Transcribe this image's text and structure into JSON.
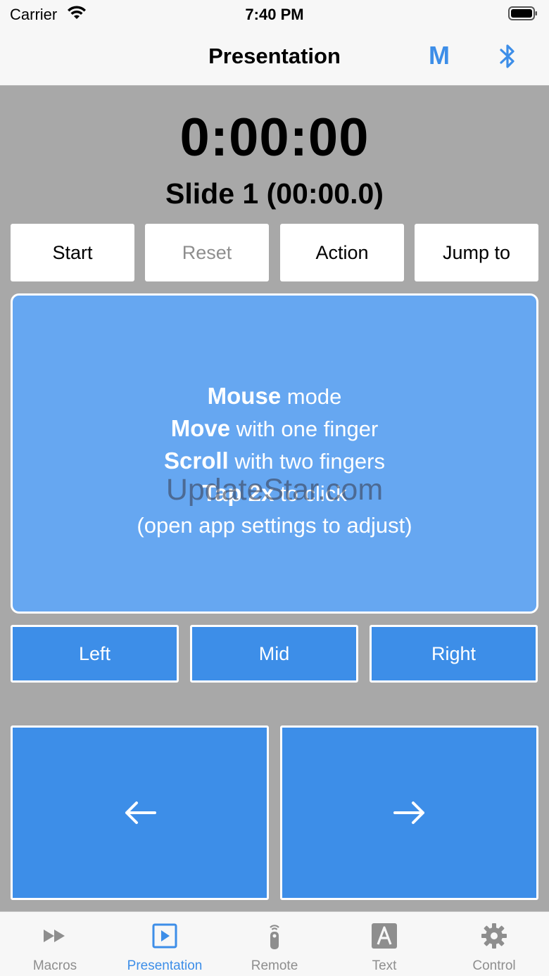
{
  "status_bar": {
    "carrier": "Carrier",
    "time": "7:40 PM"
  },
  "nav": {
    "title": "Presentation",
    "macro_button": "M"
  },
  "timer": {
    "elapsed": "0:00:00",
    "slide": "Slide 1 (00:00.0)"
  },
  "controls": [
    {
      "label": "Start",
      "enabled": true
    },
    {
      "label": "Reset",
      "enabled": false
    },
    {
      "label": "Action",
      "enabled": true
    },
    {
      "label": "Jump to",
      "enabled": true
    }
  ],
  "trackpad": {
    "line1_bold": "Mouse",
    "line1_rest": " mode",
    "line2_bold": "Move",
    "line2_rest": " with one finger",
    "line3_bold": "Scroll",
    "line3_rest": " with two fingers",
    "line4_bold": "Tap 2x",
    "line4_rest": " to click",
    "line5": "(open app settings to adjust)",
    "watermark": "UpdateStar.com"
  },
  "mouse_buttons": {
    "left": "Left",
    "mid": "Mid",
    "right": "Right"
  },
  "tabs": [
    {
      "label": "Macros",
      "icon": "fast-forward-icon",
      "active": false
    },
    {
      "label": "Presentation",
      "icon": "presentation-icon",
      "active": true
    },
    {
      "label": "Remote",
      "icon": "remote-icon",
      "active": false
    },
    {
      "label": "Text",
      "icon": "text-icon",
      "active": false
    },
    {
      "label": "Control",
      "icon": "gear-icon",
      "active": false
    }
  ],
  "colors": {
    "accent": "#3d8ee8",
    "trackpad": "#66a7f1",
    "background": "#a8a8a8",
    "inactive": "#8e8e8e"
  }
}
